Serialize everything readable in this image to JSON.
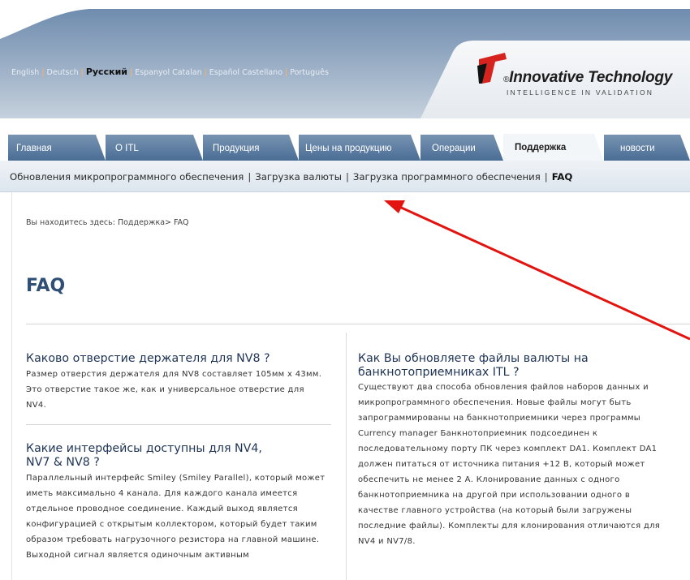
{
  "languages": [
    {
      "label": "English",
      "active": false
    },
    {
      "label": "Deutsch",
      "active": false
    },
    {
      "label": "Русский",
      "active": true
    },
    {
      "label": "Espanyol Catalan",
      "active": false
    },
    {
      "label": "Español Castellano",
      "active": false
    },
    {
      "label": "Português",
      "active": false
    }
  ],
  "logo": {
    "name": "Innovative Technology",
    "registered": "®",
    "tagline": "INTELLIGENCE IN VALIDATION",
    "icon": "logo-t-icon",
    "colors": {
      "red": "#d6231e",
      "black": "#111111"
    }
  },
  "tabs": [
    {
      "label": "Главная",
      "active": false
    },
    {
      "label": "О ITL",
      "active": false
    },
    {
      "label": "Продукция",
      "active": false
    },
    {
      "label": "Цены на продукцию",
      "active": false
    },
    {
      "label": "Операции",
      "active": false
    },
    {
      "label": "Поддержка",
      "active": true
    },
    {
      "label": "новости",
      "active": false
    }
  ],
  "subnav": {
    "links": [
      {
        "label": "Обновления микропрограммного обеспечения",
        "current": false
      },
      {
        "label": "Загрузка валюты",
        "current": false
      },
      {
        "label": "Загрузка программного обеспечения",
        "current": false
      },
      {
        "label": "FAQ",
        "current": true
      }
    ]
  },
  "breadcrumb": "Вы находитесь здесь: Поддержка> FAQ",
  "page_title": "FAQ",
  "faq": [
    {
      "title": "Каково отверстие держателя для NV8 ?",
      "body": "Размер отверстия держателя для NV8 составляет 105мм х 43мм. Это отверстие такое же, как и универсальное отверстие для NV4."
    },
    {
      "title": "Какие интерфейсы доступны для NV4, NV7 & NV8 ?",
      "body": "Параллельный интерфейс Smiley (Smiley Parallel), который может иметь максимально 4 канала. Для каждого канала имеется отдельное проводное соединение. Каждый выход является конфигурацией с открытым коллектором, который будет таким образом требовать нагрузочного резистора на главной машине. Выходной сигнал является одиночным активным"
    },
    {
      "title": "Как Вы обновляете файлы валюты на банкнотоприемниках ITL ?",
      "body": "Существуют два способа обновления файлов наборов данных и микропрограммного обеспечения. Новые файлы могут быть запрограммированы на банкнотоприемники через программы Currency manager Банкнотоприемник подсоединен к последовательному порту ПК через комплект DA1. Комплект DA1 должен питаться от источника питания +12 В, который может обеспечить не менее 2 А. Клонирование данных с одного банкнотоприемника на другой при использовании одного в качестве главного устройства (на который были загружены последние файлы). Комплекты для клонирования отличаются для NV4 и NV7/8."
    }
  ],
  "colors": {
    "tab_blue": "#5a7ca3",
    "title_blue": "#2f4f77",
    "annotation_red": "#e3140f"
  }
}
